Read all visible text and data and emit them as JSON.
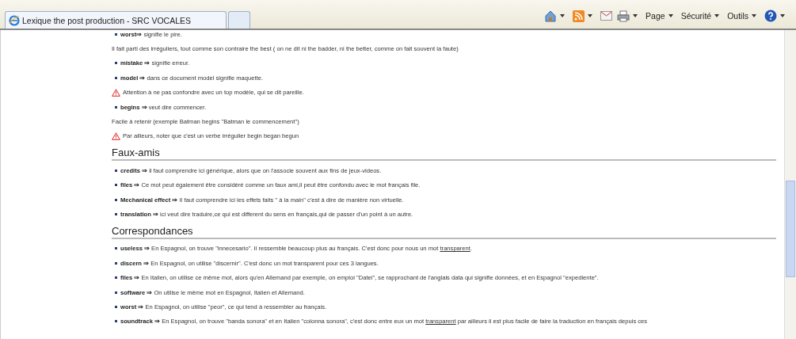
{
  "tabs": [
    {
      "label": "Lexique the post production - SRC VOCALES",
      "selected": true
    },
    {
      "selected": false
    }
  ],
  "toolbar": {
    "menus": [
      "Page",
      "Sécurité",
      "Outils"
    ]
  },
  "content": [
    {
      "kind": "bullet",
      "term": "worst⇒",
      "text": "signifie le pire."
    },
    {
      "kind": "para",
      "text": "Il fait parti des irréguliers, tout comme son contraire the best ( on ne dit ni the badder, ni the better, comme on fait souvent la faute)"
    },
    {
      "kind": "bullet",
      "term": "mistake ⇒",
      "text": "signifie erreur."
    },
    {
      "kind": "bullet",
      "term": "model ⇒",
      "text": "dans ce document model signifie maquette."
    },
    {
      "kind": "warning",
      "text": "Attention à ne pas confondre avec un top modèle, qui se dit pareille."
    },
    {
      "kind": "bullet",
      "term": "begins ⇒",
      "text": "veut dire commencer."
    },
    {
      "kind": "para",
      "text": "Facile à retenir (exemple Batman begins \"Batman le commencement\")"
    },
    {
      "kind": "warning",
      "text": "Par ailleurs, noter que c'est un verbe irrégulier begin began begun"
    },
    {
      "kind": "heading",
      "text": "Faux-amis"
    },
    {
      "kind": "bullet",
      "term": "credits ⇒",
      "text": "il faut comprendre ici générique, alors que on l'associe souvent aux fins de jeux-videos."
    },
    {
      "kind": "bullet",
      "term": "files ⇒",
      "text": "Ce mot peut également être considéré comme un faux ami,il peut être confondu avec le mot français file."
    },
    {
      "kind": "bullet",
      "term": "Mechanical effect ⇒",
      "text": "Il faut comprendre ici les effets faits \" à la main\" c'est à dire de manière non virtuelle."
    },
    {
      "kind": "bullet",
      "term": "translation ⇒",
      "text": "ici veut dire traduire,ce qui est different du sens en français,qui de passer d'un point à un autre."
    },
    {
      "kind": "heading",
      "text": "Correspondances"
    },
    {
      "kind": "bullet",
      "term": "useless ⇒",
      "text": "En Espagnol, on trouve \"innecesario\". Il ressemble beaucoup plus au français. C'est donc pour nous un mot",
      "link": "transparent",
      "after": "."
    },
    {
      "kind": "bullet",
      "term": "discern ⇒",
      "text": "En Espagnol, on utilise \"discernir\". C'est donc un mot transparent pour ces 3 langues."
    },
    {
      "kind": "bullet",
      "term": "files ⇒",
      "text": "En Italien, on utilise ce même mot, alors qu'en Allemand par exemple, on emploi \"Datei\", se rapprochant de l'anglais data qui signifie données, et en Espagnol \"expediente\"."
    },
    {
      "kind": "bullet",
      "term": "software ⇒",
      "text": "On utilise le même mot en Espagnol, Italien et Allemand."
    },
    {
      "kind": "bullet",
      "term": "worst ⇒",
      "text": "En Espagnol, on utilise \"peor\", ce qui tend à ressembler au français."
    },
    {
      "kind": "bullet",
      "term": "soundtrack ⇒",
      "text": "En Espagnol, on trouve \"banda sonora\" et en Italien \"colonna sonora\", c'est donc entre eux un mot",
      "link": "transparent",
      "after": "par ailleurs il est plus facile de faire la traduction en français depuis ces"
    }
  ]
}
